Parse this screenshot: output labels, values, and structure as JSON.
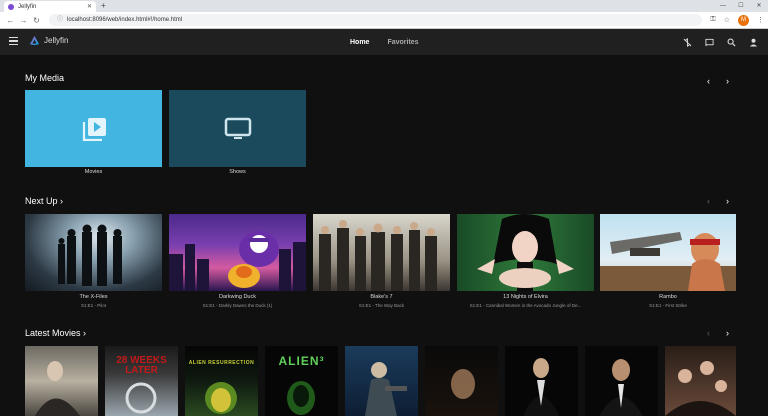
{
  "browser": {
    "tab_title": "Jellyfin",
    "url": "localhost:8096/web/index.html#!/home.html",
    "profile_initial": "M"
  },
  "header": {
    "logo_text": "Jellyfin",
    "tabs": [
      "Home",
      "Favorites"
    ],
    "accent": "#00a4dc"
  },
  "my_media": {
    "title": "My Media",
    "items": [
      {
        "label": "Movies",
        "icon": "video-library-icon",
        "color": "#42b6e0"
      },
      {
        "label": "Shows",
        "icon": "tv-icon",
        "color": "#1b4a5c"
      }
    ]
  },
  "next_up": {
    "title": "Next Up ›",
    "items": [
      {
        "title": "The X-Files",
        "subtitle": "S1:E1 - Pilot"
      },
      {
        "title": "Darkwing Duck",
        "subtitle": "S1:E1 - Darkly Dawns the Duck (1)"
      },
      {
        "title": "Blake's 7",
        "subtitle": "S1:E1 - The Way Back"
      },
      {
        "title": "13 Nights of Elvira",
        "subtitle": "S1:E1 - Cannibal Women in the Avocado Jungle of De..."
      },
      {
        "title": "Rambo",
        "subtitle": "S1:E1 - First Strike"
      }
    ]
  },
  "latest_movies": {
    "title": "Latest Movies ›",
    "poster_texts": [
      "",
      "28 WEEKS LATER",
      "ALIEN RESURRECTION",
      "ALIEN³",
      "",
      "",
      "",
      "",
      ""
    ]
  }
}
